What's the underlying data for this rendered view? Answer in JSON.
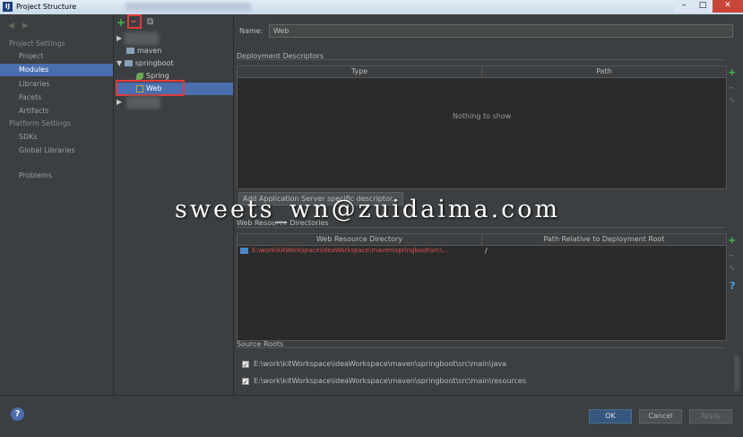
{
  "window": {
    "title": "Project Structure",
    "icon_letter": "IJ",
    "min": "–",
    "max": "□",
    "close": "✕"
  },
  "sidebar": {
    "back": "◀",
    "forward": "▶",
    "project_settings": "Project Settings",
    "project_items": [
      "Project",
      "Modules",
      "Libraries",
      "Facets",
      "Artifacts"
    ],
    "platform_settings": "Platform Settings",
    "platform_items": [
      "SDKs",
      "Global Libraries"
    ],
    "problems": "Problems"
  },
  "tree": {
    "add": "+",
    "remove": "–",
    "copy": "⧉",
    "nodes": {
      "maven": "maven",
      "springboot": "springboot",
      "spring": "Spring",
      "web": "Web"
    }
  },
  "main": {
    "name_label": "Name:",
    "name_value": "Web",
    "deployment": {
      "title": "Deployment Descriptors",
      "col_type": "Type",
      "col_path": "Path",
      "empty": "Nothing to show",
      "add_button": "Add Application Server specific descriptor..."
    },
    "web_resource": {
      "title": "Web Resource Directories",
      "col_dir": "Web Resource Directory",
      "col_rel": "Path Relative to Deployment Root",
      "row_dir": "E:\\work\\kitWorkspace\\ideaWorkspace\\maven\\springboot\\src\\...",
      "row_rel": "/"
    },
    "source_roots": {
      "title": "Source Roots",
      "items": [
        "E:\\work\\kitWorkspace\\ideaWorkspace\\maven\\springboot\\src\\main\\java",
        "E:\\work\\kitWorkspace\\ideaWorkspace\\maven\\springboot\\src\\main\\resources"
      ]
    },
    "tools": {
      "add": "+",
      "remove": "–",
      "edit": "✎",
      "help": "?"
    }
  },
  "footer": {
    "help": "?",
    "ok": "OK",
    "cancel": "Cancel",
    "apply": "Apply"
  },
  "watermark": "sweets_wn@zuidaima.com",
  "colors": {
    "selection": "#4b6eaf",
    "add_green": "#3fb950",
    "path_red": "#d9534f",
    "highlight_red": "#e23b3b"
  }
}
